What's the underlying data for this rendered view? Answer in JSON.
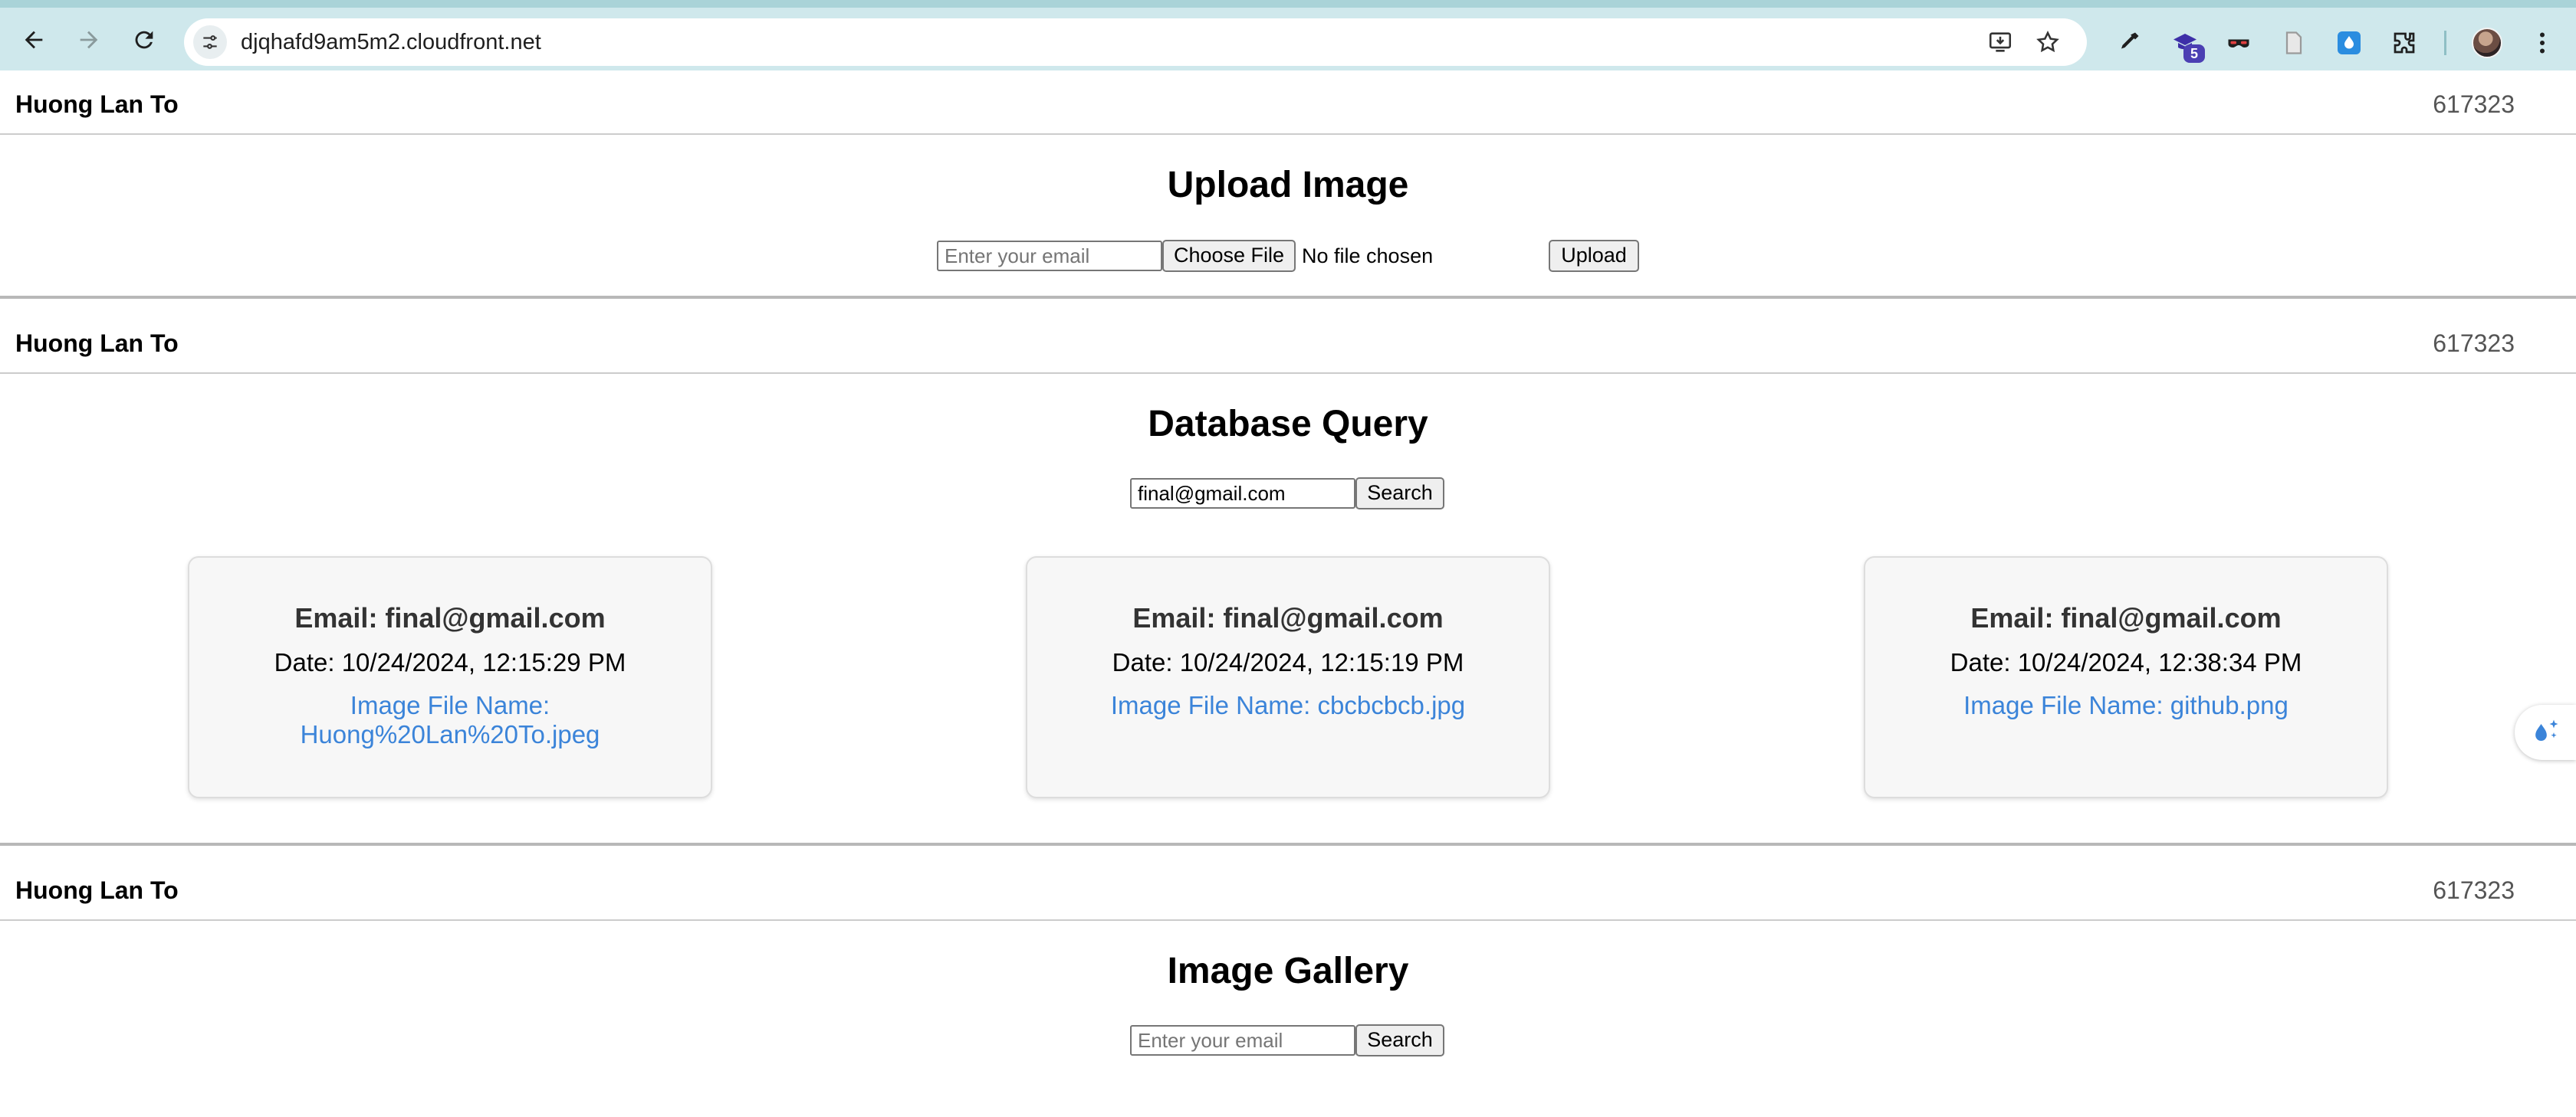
{
  "browser": {
    "url": "djqhafd9am5m2.cloudfront.net",
    "extension_badge": "5"
  },
  "sections": [
    {
      "author": "Huong Lan To",
      "code": "617323",
      "title": "Upload Image"
    },
    {
      "author": "Huong Lan To",
      "code": "617323",
      "title": "Database Query"
    },
    {
      "author": "Huong Lan To",
      "code": "617323",
      "title": "Image Gallery"
    }
  ],
  "upload": {
    "email_placeholder": "Enter your email",
    "choose_file_label": "Choose File",
    "file_status": "No file chosen",
    "upload_label": "Upload"
  },
  "query": {
    "email_value": "final@gmail.com",
    "search_label": "Search"
  },
  "results": [
    {
      "email": "Email: final@gmail.com",
      "date": "Date: 10/24/2024, 12:15:29 PM",
      "file": "Image File Name: Huong%20Lan%20To.jpeg"
    },
    {
      "email": "Email: final@gmail.com",
      "date": "Date: 10/24/2024, 12:15:19 PM",
      "file": "Image File Name: cbcbcbcb.jpg"
    },
    {
      "email": "Email: final@gmail.com",
      "date": "Date: 10/24/2024, 12:38:34 PM",
      "file": "Image File Name: github.png"
    }
  ],
  "gallery": {
    "email_placeholder": "Enter your email",
    "search_label": "Search"
  },
  "colors": {
    "link": "#3b84d9",
    "chrome": "#cfe8ec"
  }
}
